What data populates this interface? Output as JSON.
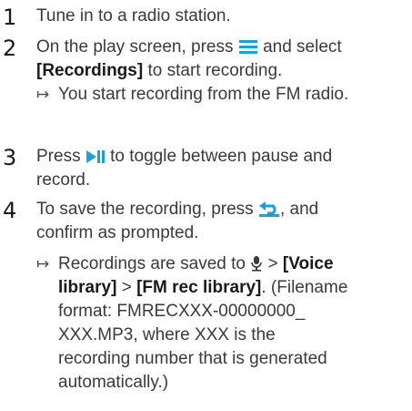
{
  "steps": [
    {
      "number": "1",
      "lines": [
        "Tune in to a radio station."
      ]
    },
    {
      "number": "2",
      "text_a": "On the play screen, press",
      "text_b": "and select",
      "bold_a": "[Recordings]",
      "text_c": "to start recording.",
      "result": "You start recording from the FM radio."
    },
    {
      "number": "3",
      "text_a": "Press",
      "text_b": "to toggle between pause and",
      "text_c": "record."
    },
    {
      "number": "4",
      "text_a": "To save the recording, press",
      "text_b": ", and",
      "text_c": "confirm as prompted.",
      "result_a": "Recordings are saved to",
      "sep1": ">",
      "bold_a": "[Voice",
      "bold_b": "library]",
      "sep2": ">",
      "bold_c": "[FM rec library]",
      "result_b": ". (Filename",
      "result_c": "format: FMRECXXX-00000000_",
      "result_d": "XXX.MP3, where XXX is the",
      "result_e": "recording number that is generated",
      "result_f": "automatically.)"
    }
  ],
  "icons": {
    "menu": "menu-icon",
    "play_pause": "play-pause-icon",
    "back": "back-icon",
    "mic": "microphone-icon",
    "result_arrow": "result-arrow-icon"
  },
  "colors": {
    "accent": "#1aa0d8",
    "text": "#3a3a3a",
    "heading": "#1a1a1a"
  }
}
